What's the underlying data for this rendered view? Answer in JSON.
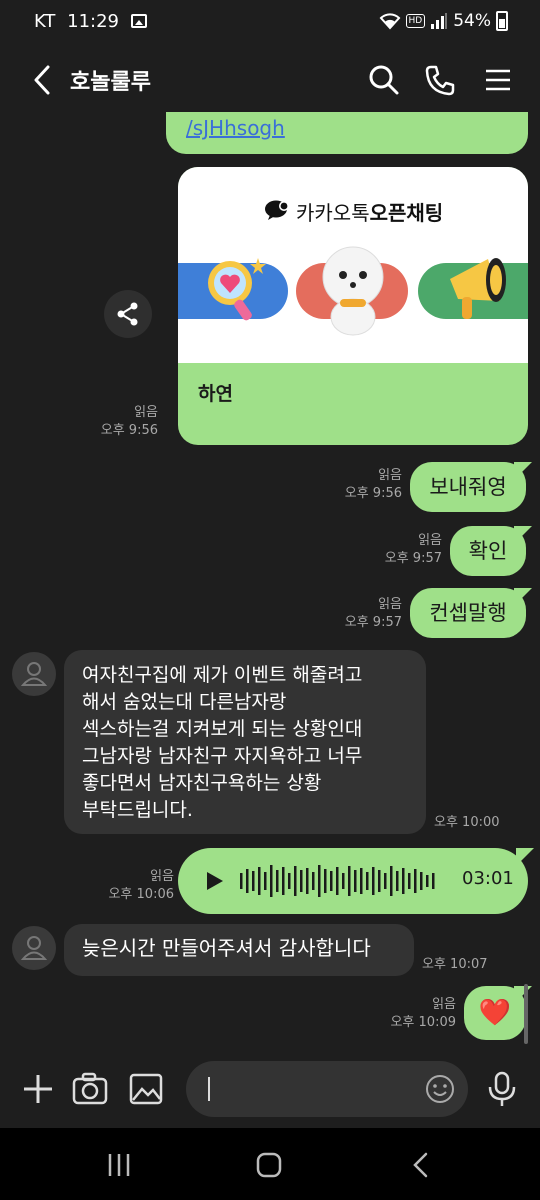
{
  "status_bar": {
    "carrier": "KT",
    "time": "11:29",
    "hd": "HD",
    "battery": "54%"
  },
  "header": {
    "title": "호놀룰루"
  },
  "messages": {
    "link_top": "/sJHhsogh",
    "card": {
      "brand_regular": "카카오톡",
      "brand_bold": "오픈채팅",
      "name": "하연",
      "read": "읽음",
      "time": "오후 9:56"
    },
    "m1": {
      "text": "보내줘영",
      "read": "읽음",
      "time": "오후 9:56"
    },
    "m2": {
      "text": "확인",
      "read": "읽음",
      "time": "오후 9:57"
    },
    "m3": {
      "text": "컨셉말행",
      "read": "읽음",
      "time": "오후 9:57"
    },
    "o1": {
      "lines": [
        "여자친구집에 제가 이벤트 해줄려고",
        "해서 숨었는대 다른남자랑",
        "섹스하는걸 지켜보게 되는 상황인대",
        "그남자랑 남자친구 자지욕하고 너무",
        "좋다면서 남자친구욕하는 상황",
        "부탁드립니다."
      ],
      "time": "오후 10:00"
    },
    "voice": {
      "duration": "03:01",
      "read": "읽음",
      "time": "오후 10:06"
    },
    "o2": {
      "text": "늦은시간 만들어주셔서 감사합니다",
      "time": "오후 10:07"
    },
    "m4": {
      "text": "❤️",
      "read": "읽음",
      "time": "오후 10:09"
    }
  },
  "icons": [
    "back-arrow-icon",
    "search-icon",
    "phone-icon",
    "menu-icon",
    "share-icon",
    "play-icon",
    "plus-icon",
    "camera-icon",
    "image-icon",
    "emoji-icon",
    "mic-icon"
  ],
  "colors": {
    "my_bubble": "#9fe089",
    "other_bubble": "#333333",
    "background": "#1e1e1e"
  }
}
